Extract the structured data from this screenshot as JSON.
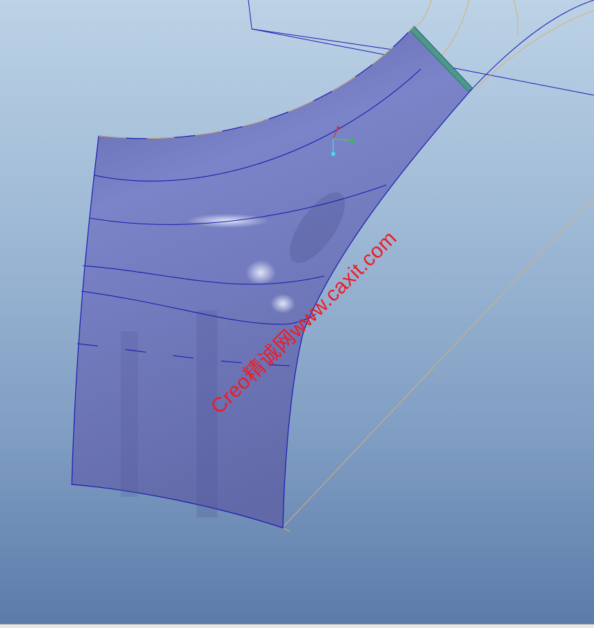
{
  "viewport": {
    "background_top": "#bcd2e6",
    "background_bottom": "#5b7aa8",
    "surface_color": "#7880c4",
    "edge_color": "#1a1ab0",
    "boundary_color": "#d8b070"
  },
  "watermark": {
    "text": "Creo精诚网www.caxit.com",
    "color": "#ee1c24"
  }
}
